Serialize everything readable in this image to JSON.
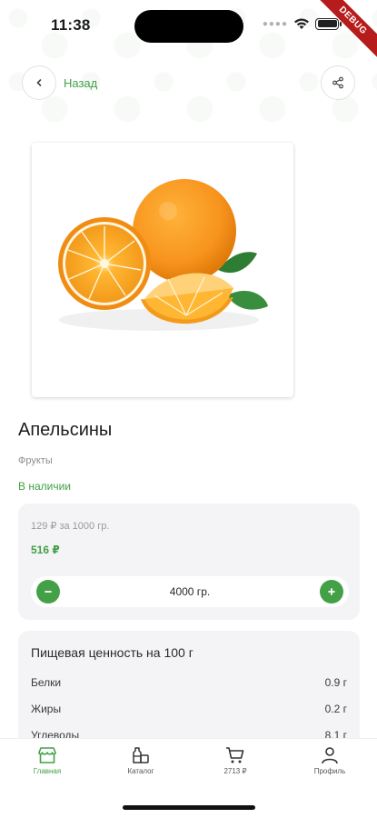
{
  "status_bar": {
    "time": "11:38",
    "debug_label": "DEBUG"
  },
  "header": {
    "back_label": "Назад"
  },
  "product": {
    "title": "Апельсины",
    "category": "Фрукты",
    "availability": "В наличии",
    "image_subject": "orange-fruit-image"
  },
  "pricing": {
    "unit_price": "129 ₽ за 1000 гр.",
    "total": "516 ₽",
    "quantity": "4000 гр."
  },
  "nutrition": {
    "title": "Пищевая ценность на 100 г",
    "rows": [
      {
        "label": "Белки",
        "value": "0.9 г"
      },
      {
        "label": "Жиры",
        "value": "0.2 г"
      },
      {
        "label": "Углеводы",
        "value": "8.1 г"
      }
    ]
  },
  "nav": {
    "items": [
      {
        "label": "Главная",
        "icon": "store-icon",
        "active": true
      },
      {
        "label": "Каталог",
        "icon": "catalog-icon",
        "active": false
      },
      {
        "label": "2713 ₽",
        "icon": "cart-icon",
        "active": false
      },
      {
        "label": "Профиль",
        "icon": "profile-icon",
        "active": false
      }
    ]
  },
  "colors": {
    "accent": "#43a047",
    "card_bg": "#f4f4f6",
    "debug": "#b71c1c"
  }
}
